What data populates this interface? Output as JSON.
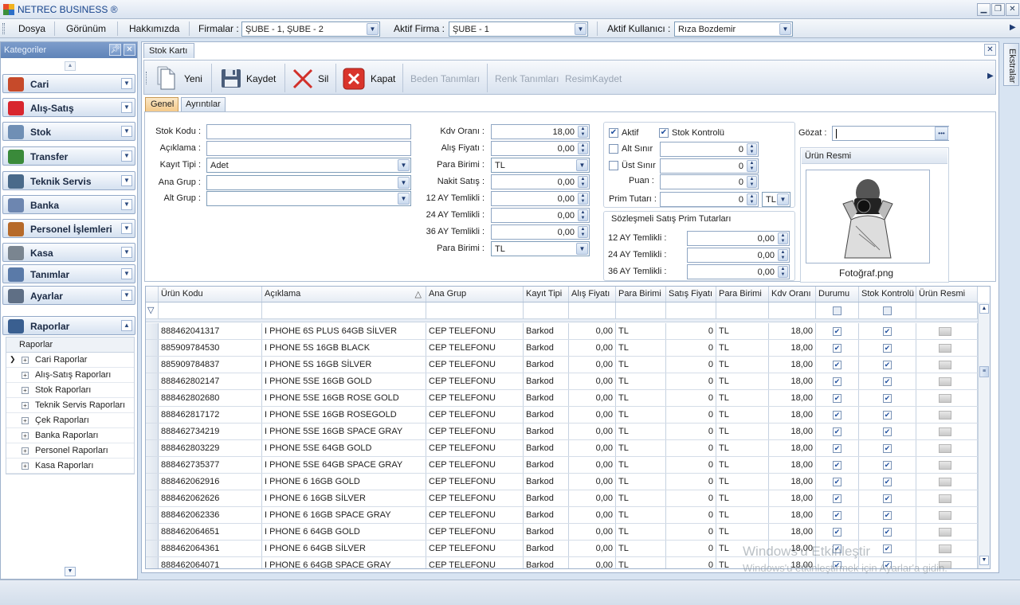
{
  "window": {
    "title": "NETREC BUSINESS ®",
    "min": "▁",
    "max": "❐",
    "close": "✕"
  },
  "menu": {
    "dosya": "Dosya",
    "gorunum": "Görünüm",
    "hakkimizda": "Hakkımızda"
  },
  "firmalar": {
    "label": "Firmalar :",
    "value": "ŞUBE - 1, ŞUBE - 2"
  },
  "aktif_firma": {
    "label": "Aktif Firma :",
    "value": "ŞUBE - 1"
  },
  "aktif_kullanici": {
    "label": "Aktif Kullanıcı :",
    "value": "Rıza Bozdemir"
  },
  "sidebar": {
    "title": "Kategoriler",
    "groups": [
      {
        "label": "Cari",
        "icon": "person-icon",
        "color": "#c64a2a"
      },
      {
        "label": "Alış-Satış",
        "icon": "shopping-bag-icon",
        "color": "#d8262e"
      },
      {
        "label": "Stok",
        "icon": "box-icon",
        "color": "#6f8fb5"
      },
      {
        "label": "Transfer",
        "icon": "transfer-icon",
        "color": "#3a8a3a"
      },
      {
        "label": "Teknik Servis",
        "icon": "toolbox-icon",
        "color": "#4a6a8a"
      },
      {
        "label": "Banka",
        "icon": "bank-icon",
        "color": "#6d86b0"
      },
      {
        "label": "Personel İşlemleri",
        "icon": "people-icon",
        "color": "#b66a2a"
      },
      {
        "label": "Kasa",
        "icon": "safe-icon",
        "color": "#7a8590"
      },
      {
        "label": "Tanımlar",
        "icon": "list-icon",
        "color": "#5a7aa8"
      },
      {
        "label": "Ayarlar",
        "icon": "wrench-icon",
        "color": "#5f6f85"
      },
      {
        "label": "Raporlar",
        "icon": "books-icon",
        "color": "#3a5f90"
      }
    ],
    "reports_header": "Raporlar",
    "reports": [
      "Cari Raporlar",
      "Alış-Satış Raporları",
      "Stok Raporları",
      "Teknik Servis Raporları",
      "Çek Raporları",
      "Banka Raporları",
      "Personel Raporları",
      "Kasa Raporları"
    ]
  },
  "right_strip": {
    "label": "Ekstralar"
  },
  "doc_tab": "Stok Kartı",
  "toolbar": {
    "yeni": "Yeni",
    "kaydet": "Kaydet",
    "sil": "Sil",
    "kapat": "Kapat",
    "beden": "Beden Tanımları",
    "renk": "Renk Tanımları",
    "resim": "ResimKaydet"
  },
  "subtabs": {
    "genel": "Genel",
    "ayrintilar": "Ayrıntılar"
  },
  "form": {
    "stok_kodu": {
      "label": "Stok Kodu :",
      "value": ""
    },
    "aciklama": {
      "label": "Açıklama :",
      "value": ""
    },
    "kayit_tipi": {
      "label": "Kayıt Tipi :",
      "value": "Adet"
    },
    "ana_grup": {
      "label": "Ana Grup :",
      "value": ""
    },
    "alt_grup": {
      "label": "Alt Grup :",
      "value": ""
    },
    "kdv_orani": {
      "label": "Kdv Oranı :",
      "value": "18,00"
    },
    "alis_fiyati": {
      "label": "Alış Fiyatı :",
      "value": "0,00"
    },
    "para_birimi1": {
      "label": "Para Birimi :",
      "value": "TL"
    },
    "nakit_satis": {
      "label": "Nakit Satış :",
      "value": "0,00"
    },
    "ay12": {
      "label": "12 AY Temlikli :",
      "value": "0,00"
    },
    "ay24": {
      "label": "24 AY Temlikli :",
      "value": "0,00"
    },
    "ay36": {
      "label": "36 AY Temlikli :",
      "value": "0,00"
    },
    "para_birimi2": {
      "label": "Para Birimi :",
      "value": "TL"
    },
    "aktif": "Aktif",
    "stok_kontrolu": "Stok Kontrolü",
    "alt_sinir": {
      "label": "Alt Sınır",
      "value": "0"
    },
    "ust_sinir": {
      "label": "Üst Sınır",
      "value": "0"
    },
    "puan": {
      "label": "Puan :",
      "value": "0"
    },
    "prim_tutari": {
      "label": "Prim Tutarı :",
      "value": "0",
      "currency": "TL"
    },
    "sozlesmeli_title": "Sözleşmeli Satış Prim Tutarları",
    "s12": {
      "label": "12 AY Temlikli :",
      "value": "0,00"
    },
    "s24": {
      "label": "24 AY Temlikli :",
      "value": "0,00"
    },
    "s36": {
      "label": "36 AY Temlikli :",
      "value": "0,00"
    },
    "gozat_label": "Gözat :",
    "gozat_btn": "•••",
    "urun_resmi_title": "Ürün Resmi",
    "photo_name": "Fotoğraf.png"
  },
  "grid": {
    "columns": [
      "Ürün Kodu",
      "Açıklama",
      "Ana Grup",
      "Kayıt Tipi",
      "Alış Fiyatı",
      "Para Birimi",
      "Satış Fiyatı",
      "Para Birimi",
      "Kdv Oranı",
      "Durumu",
      "Stok Kontrolü",
      "Ürün Resmi"
    ],
    "sort_arrow": "△",
    "filter_icon": "▽",
    "rows": [
      [
        "888462041317",
        "I PHOHE 6S PLUS 64GB SİLVER",
        "CEP TELEFONU",
        "Barkod",
        "0,00",
        "TL",
        "0",
        "TL",
        "18,00"
      ],
      [
        "885909784530",
        "I PHONE 5S 16GB BLACK",
        "CEP TELEFONU",
        "Barkod",
        "0,00",
        "TL",
        "0",
        "TL",
        "18,00"
      ],
      [
        "885909784837",
        "I PHONE 5S 16GB SİLVER",
        "CEP TELEFONU",
        "Barkod",
        "0,00",
        "TL",
        "0",
        "TL",
        "18,00"
      ],
      [
        "888462802147",
        "I PHONE 5SE 16GB GOLD",
        "CEP TELEFONU",
        "Barkod",
        "0,00",
        "TL",
        "0",
        "TL",
        "18,00"
      ],
      [
        "888462802680",
        "I PHONE 5SE 16GB ROSE GOLD",
        "CEP TELEFONU",
        "Barkod",
        "0,00",
        "TL",
        "0",
        "TL",
        "18,00"
      ],
      [
        "888462817172",
        "I PHONE 5SE 16GB ROSEGOLD",
        "CEP TELEFONU",
        "Barkod",
        "0,00",
        "TL",
        "0",
        "TL",
        "18,00"
      ],
      [
        "888462734219",
        "I PHONE 5SE 16GB SPACE GRAY",
        "CEP TELEFONU",
        "Barkod",
        "0,00",
        "TL",
        "0",
        "TL",
        "18,00"
      ],
      [
        "888462803229",
        "I PHONE 5SE 64GB GOLD",
        "CEP TELEFONU",
        "Barkod",
        "0,00",
        "TL",
        "0",
        "TL",
        "18,00"
      ],
      [
        "888462735377",
        "I PHONE 5SE 64GB SPACE GRAY",
        "CEP TELEFONU",
        "Barkod",
        "0,00",
        "TL",
        "0",
        "TL",
        "18,00"
      ],
      [
        "888462062916",
        "I PHONE 6 16GB GOLD",
        "CEP TELEFONU",
        "Barkod",
        "0,00",
        "TL",
        "0",
        "TL",
        "18,00"
      ],
      [
        "888462062626",
        "I PHONE 6 16GB SİLVER",
        "CEP TELEFONU",
        "Barkod",
        "0,00",
        "TL",
        "0",
        "TL",
        "18,00"
      ],
      [
        "888462062336",
        "I PHONE 6 16GB SPACE GRAY",
        "CEP TELEFONU",
        "Barkod",
        "0,00",
        "TL",
        "0",
        "TL",
        "18,00"
      ],
      [
        "888462064651",
        "I PHONE 6 64GB GOLD",
        "CEP TELEFONU",
        "Barkod",
        "0,00",
        "TL",
        "0",
        "TL",
        "18,00"
      ],
      [
        "888462064361",
        "I PHONE 6 64GB SİLVER",
        "CEP TELEFONU",
        "Barkod",
        "0,00",
        "TL",
        "0",
        "TL",
        "18,00"
      ],
      [
        "888462064071",
        "I PHONE 6 64GB SPACE GRAY",
        "CEP TELEFONU",
        "Barkod",
        "0,00",
        "TL",
        "0",
        "TL",
        "18,00"
      ]
    ]
  },
  "watermark": {
    "line1": "Windows'u Etkinleştir",
    "line2": "Windows'u etkinleştirmek için Ayarlar'a gidin."
  }
}
